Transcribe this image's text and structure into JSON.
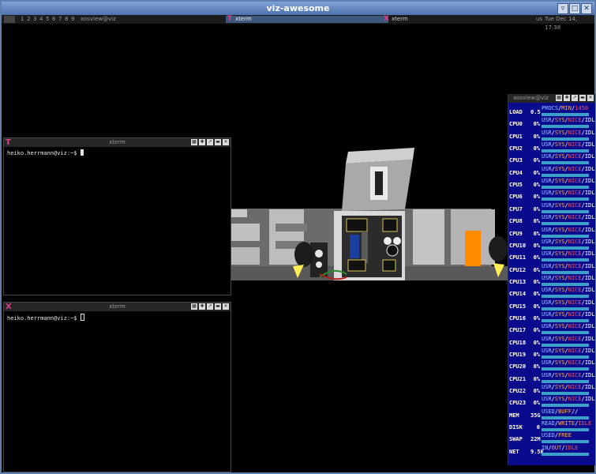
{
  "window": {
    "title": "viz-awesome",
    "buttons": {
      "minimize": "▿",
      "maximize": "□",
      "close": "✕"
    }
  },
  "wibox": {
    "layout_icon": "tile-layout-icon",
    "tags": [
      "1",
      "2",
      "3",
      "4",
      "5",
      "6",
      "7",
      "8",
      "9"
    ],
    "tasks": [
      {
        "label": "xosview@viz",
        "icon": ""
      },
      {
        "label": "xterm",
        "icon": "T",
        "focused": true
      },
      {
        "label": "xterm",
        "icon": "X",
        "focused": false
      }
    ],
    "keyboard_layout": "us",
    "clock": "Tue Dec 14, 17:38"
  },
  "terminals": [
    {
      "title": "xterm",
      "icon": "T",
      "prompt": "heiko.herrmann@viz:~$ "
    },
    {
      "title": "xterm",
      "icon": "X",
      "prompt": "heiko.herrmann@viz:~$ "
    }
  ],
  "xosview": {
    "title": "xosview@viz",
    "load": {
      "name": "LOAD",
      "value": "0.5",
      "legend": [
        "PROCS",
        "MIN",
        "1450"
      ]
    },
    "cpus": [
      {
        "name": "CPU0",
        "value": "0%"
      },
      {
        "name": "CPU1",
        "value": "0%"
      },
      {
        "name": "CPU2",
        "value": "0%"
      },
      {
        "name": "CPU3",
        "value": "0%"
      },
      {
        "name": "CPU4",
        "value": "0%"
      },
      {
        "name": "CPU5",
        "value": "0%"
      },
      {
        "name": "CPU6",
        "value": "0%"
      },
      {
        "name": "CPU7",
        "value": "0%"
      },
      {
        "name": "CPU8",
        "value": "0%"
      },
      {
        "name": "CPU9",
        "value": "0%"
      },
      {
        "name": "CPU10",
        "value": "0%"
      },
      {
        "name": "CPU11",
        "value": "0%"
      },
      {
        "name": "CPU12",
        "value": "0%"
      },
      {
        "name": "CPU13",
        "value": "0%"
      },
      {
        "name": "CPU14",
        "value": "0%"
      },
      {
        "name": "CPU15",
        "value": "0%"
      },
      {
        "name": "CPU16",
        "value": "0%"
      },
      {
        "name": "CPU17",
        "value": "0%"
      },
      {
        "name": "CPU18",
        "value": "0%"
      },
      {
        "name": "CPU19",
        "value": "0%"
      },
      {
        "name": "CPU20",
        "value": "0%"
      },
      {
        "name": "CPU21",
        "value": "0%"
      },
      {
        "name": "CPU22",
        "value": "0%"
      },
      {
        "name": "CPU23",
        "value": "0%"
      }
    ],
    "cpu_legend": [
      "USR",
      "SYS",
      "NICE",
      "IDL"
    ],
    "mem": {
      "name": "MEM",
      "value": "35G",
      "legend": [
        "USED",
        "BUFF",
        "",
        ""
      ]
    },
    "disk": {
      "name": "DISK",
      "value": "0",
      "legend": [
        "READ",
        "WRITE",
        "IDLE"
      ]
    },
    "swap": {
      "name": "SWAP",
      "value": "22M",
      "legend": [
        "USED",
        "FREE"
      ]
    },
    "net": {
      "name": "NET",
      "value": "9.5K",
      "legend": [
        "IN",
        "OUT",
        "IDLE"
      ]
    }
  },
  "colors": {
    "accent": "#5f7fae",
    "xosview_bg": "#0a0a8c",
    "meter_track": "#3aa0c8"
  }
}
